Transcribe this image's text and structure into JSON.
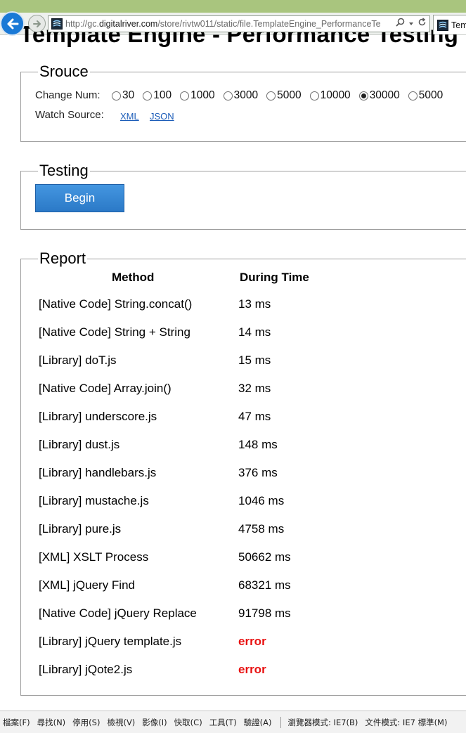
{
  "browser": {
    "url_prefix": "http://gc.",
    "url_host": "digitalriver.com",
    "url_rest": "/store/rivtw011/static/file.TemplateEngine_PerformanceTe",
    "tab_label": "Tem"
  },
  "page": {
    "title": "Template Engine - Performance Testing"
  },
  "source": {
    "legend": "Srouce",
    "change_num_label": "Change Num:",
    "options": [
      "30",
      "100",
      "1000",
      "3000",
      "5000",
      "10000",
      "30000",
      "5000"
    ],
    "selected_index": 6,
    "watch_label": "Watch Source:",
    "xml_link": "XML",
    "json_link": "JSON"
  },
  "testing": {
    "legend": "Testing",
    "begin_label": "Begin"
  },
  "report": {
    "legend": "Report",
    "col_method": "Method",
    "col_time": "During Time",
    "rows": [
      {
        "method": "[Native Code] String.concat()",
        "time": "13 ms"
      },
      {
        "method": "[Native Code] String + String",
        "time": "14 ms"
      },
      {
        "method": "[Library] doT.js",
        "time": "15 ms"
      },
      {
        "method": "[Native Code] Array.join()",
        "time": "32 ms"
      },
      {
        "method": "[Library] underscore.js",
        "time": "47 ms"
      },
      {
        "method": "[Library] dust.js",
        "time": "148 ms"
      },
      {
        "method": "[Library] handlebars.js",
        "time": "376 ms"
      },
      {
        "method": "[Library] mustache.js",
        "time": "1046 ms"
      },
      {
        "method": "[Library] pure.js",
        "time": "4758 ms"
      },
      {
        "method": "[XML] XSLT Process",
        "time": "50662 ms"
      },
      {
        "method": "[XML] jQuery Find",
        "time": "68321 ms"
      },
      {
        "method": "[Native Code] jQuery Replace",
        "time": "91798 ms"
      },
      {
        "method": "[Library] jQuery template.js",
        "time": "error"
      },
      {
        "method": "[Library] jQote2.js",
        "time": "error"
      }
    ]
  },
  "menubar": {
    "items": [
      "檔案(F)",
      "尋找(N)",
      "停用(S)",
      "檢視(V)",
      "影像(I)",
      "快取(C)",
      "工具(T)",
      "驗證(A)"
    ],
    "mode_items": [
      "瀏覽器模式: IE7(B)",
      "文件模式: IE7 標準(M)"
    ]
  },
  "colors": {
    "accent": "#2b79c7",
    "error": "#e81010",
    "chrome_green": "#a9c57e"
  }
}
